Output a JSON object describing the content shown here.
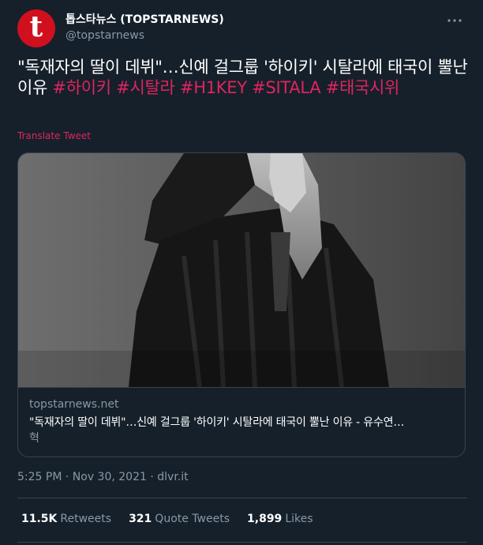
{
  "author": {
    "avatar_letter": "t",
    "display_name": "톱스타뉴스 (TOPSTARNEWS)",
    "handle": "@topstarnews",
    "avatar_color": "#d0101e"
  },
  "more_icon": "more-horizontal-icon",
  "tweet": {
    "text_main": "\"독재자의 딸이 데뷔\"…신예 걸그룹 '하이키' 시탈라에 태국이 뿔난 이유 ",
    "hashtags": [
      "#하이키",
      "#시탈라",
      "#H1KEY",
      "#SITALA",
      "#태국시위"
    ],
    "translate_label": "Translate Tweet"
  },
  "card": {
    "image_description": "photo-card-image",
    "domain": "topstarnews.net",
    "title_line1": "\"독재자의 딸이 데뷔\"…신예 걸그룹 '하이키' 시탈라에 태국이 뿔난 이유 - 유수연…",
    "title_line2": "혁"
  },
  "meta": {
    "time": "5:25 PM",
    "separator1": " · ",
    "date": "Nov 30, 2021",
    "separator2": " · ",
    "source": "dlvr.it"
  },
  "stats": {
    "retweets_count": "11.5K",
    "retweets_label": "Retweets",
    "quotes_count": "321",
    "quotes_label": "Quote Tweets",
    "likes_count": "1,899",
    "likes_label": "Likes"
  },
  "colors": {
    "background": "#15202b",
    "accent": "#e0245e",
    "muted": "#8b98a5",
    "border": "#38444d"
  }
}
